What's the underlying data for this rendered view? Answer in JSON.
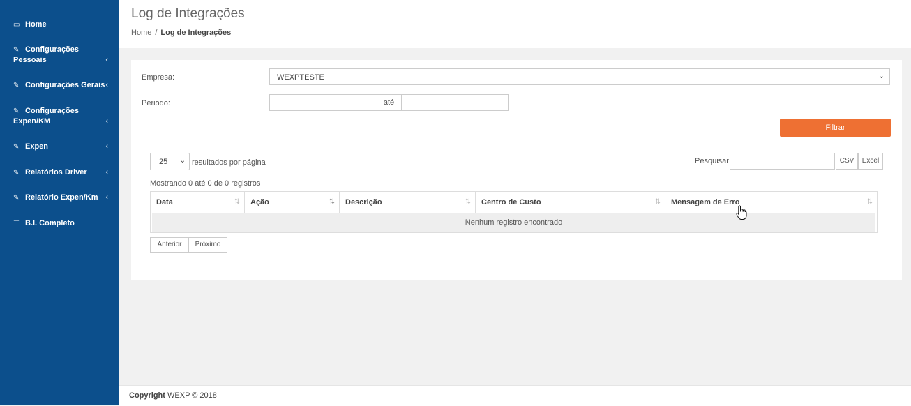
{
  "sidebar": {
    "items": [
      {
        "label": "Home",
        "icon": "laptop-icon"
      },
      {
        "label": "Configurações",
        "label2": "Pessoais",
        "icon": "edit-icon"
      },
      {
        "label": "Configurações Gerais",
        "icon": "edit-icon"
      },
      {
        "label": "Configurações",
        "label2": "Expen/KM",
        "icon": "edit-icon"
      },
      {
        "label": "Expen",
        "icon": "edit-icon"
      },
      {
        "label": "Relatórios Driver",
        "icon": "edit-icon"
      },
      {
        "label": "Relatório Expen/Km",
        "icon": "edit-icon"
      },
      {
        "label": "B.I. Completo",
        "icon": "list-icon"
      }
    ]
  },
  "header": {
    "title": "Log de Integrações",
    "breadcrumb": {
      "home": "Home",
      "separator": "/",
      "current": "Log de Integrações"
    }
  },
  "filters": {
    "empresa_label": "Empresa:",
    "empresa_value": "WEXPTESTE",
    "periodo_label": "Periodo:",
    "ate_label": "até",
    "filtrar_label": "Filtrar"
  },
  "table_controls": {
    "page_length": "25",
    "page_length_suffix": "resultados por página",
    "search_label": "Pesquisar",
    "csv_label": "CSV",
    "excel_label": "Excel",
    "info": "Mostrando 0 até 0 de 0 registros"
  },
  "table": {
    "columns": [
      "Data",
      "Ação",
      "Descrição",
      "Centro de Custo",
      "Mensagem de Erro"
    ],
    "empty_message": "Nenhum registro encontrado"
  },
  "pagination": {
    "previous": "Anterior",
    "next": "Próximo"
  },
  "footer": {
    "copyright_bold": "Copyright",
    "copyright_rest": "WEXP © 2018"
  },
  "colors": {
    "sidebar": "#0c4f8c",
    "accent": "#ee7033"
  }
}
